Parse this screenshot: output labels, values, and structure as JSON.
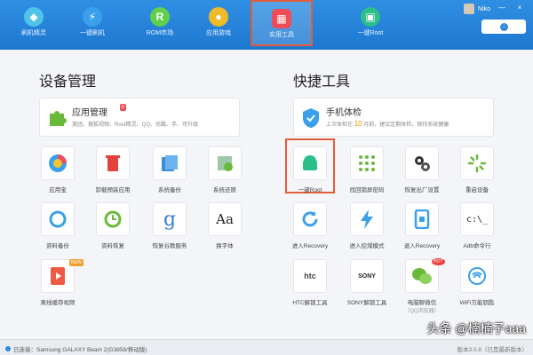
{
  "nav": {
    "items": [
      {
        "label": "刷机精灵"
      },
      {
        "label": "一键刷机"
      },
      {
        "label": "ROM市场"
      },
      {
        "label": "应用游戏"
      },
      {
        "label": "实用工具"
      },
      {
        "label": "一键Root"
      }
    ],
    "active_index": 4,
    "user_name": "Niko",
    "controls": [
      "—",
      "×"
    ]
  },
  "left": {
    "title": "设备管理",
    "banner": {
      "title": "应用管理",
      "badge": "6",
      "desc": "美团、搜狐视频、Root精灵、QQ、优酷、手、可升级"
    },
    "tiles": [
      {
        "label": "应用宝"
      },
      {
        "label": "卸载预装应用"
      },
      {
        "label": "系统备份"
      },
      {
        "label": "系统还原"
      },
      {
        "label": "资料备份"
      },
      {
        "label": "资料恢复"
      },
      {
        "label": "恢复谷歌服务"
      },
      {
        "label": "换字体",
        "glyph": "Aa"
      },
      {
        "label": "离线缓存视频",
        "badge": "NEW"
      }
    ]
  },
  "right": {
    "title": "快捷工具",
    "banner": {
      "title": "手机体检",
      "desc_prefix": "上次体检在",
      "desc_num": "10",
      "desc_suffix": "月前，建议定期体检，保持系统健康"
    },
    "tiles": [
      {
        "label": "一键Root"
      },
      {
        "label": "找回锁屏密码"
      },
      {
        "label": "恢复出厂设置"
      },
      {
        "label": "重启设备"
      },
      {
        "label": "进入Recovery"
      },
      {
        "label": "进入挖煤模式"
      },
      {
        "label": "退入Recovery"
      },
      {
        "label": "Adb命令行",
        "glyph": "c:\\_"
      },
      {
        "label": "HTC解锁工具",
        "glyph": "htc"
      },
      {
        "label": "SONY解锁工具",
        "glyph": "SONY"
      },
      {
        "label": "电脑聊微信",
        "sub": "（QQ浏览器）",
        "badge": "HOT"
      },
      {
        "label": "WiFi万能钥匙"
      }
    ]
  },
  "status": {
    "text": "已连接：Samsung GALAXY Beam 2(G3858/移动版)",
    "version": "版本3.0.8（已是最新版本）"
  },
  "watermark": "头条 @楠楠子aaa",
  "colors": {
    "topbar": "#1e78d0",
    "highlight": "#e05c3b",
    "accent_green": "#69b93a"
  }
}
